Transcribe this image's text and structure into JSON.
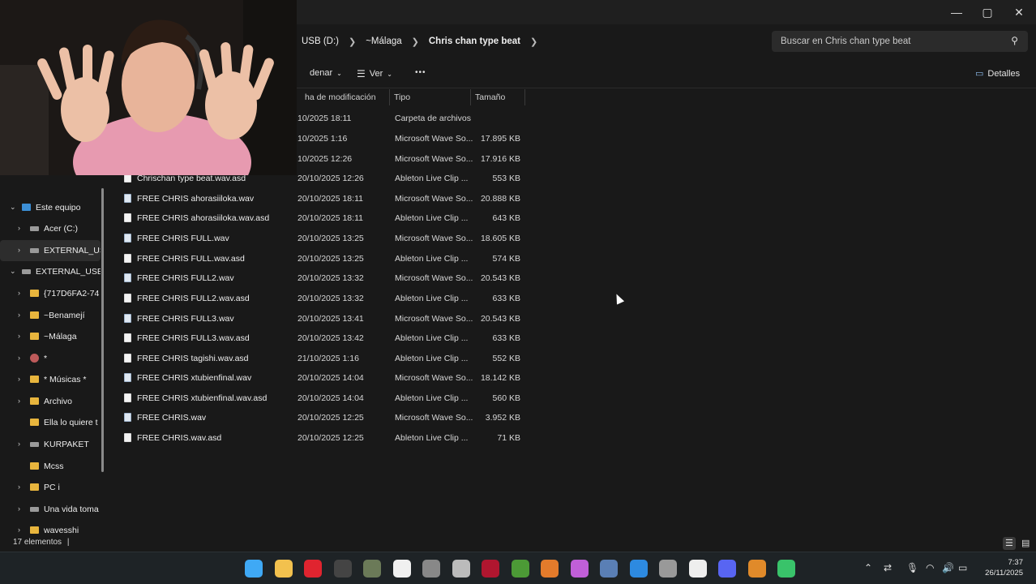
{
  "window": {
    "minimize": "—",
    "maximize": "▢",
    "close": "✕"
  },
  "address": {
    "crumbs": [
      "USB (D:)",
      "~Málaga",
      "Chris chan type beat"
    ],
    "search_placeholder": "Buscar en Chris chan type beat"
  },
  "toolbar": {
    "sort_label": "denar",
    "view_label": "Ver",
    "more_label": "•••",
    "details_label": "Detalles"
  },
  "columns": {
    "date": "ha de modificación",
    "type": "Tipo",
    "size": "Tamaño"
  },
  "files": [
    {
      "name": "",
      "date": "10/2025 18:11",
      "type": "Carpeta de archivos",
      "size": "",
      "kind": "folder"
    },
    {
      "name": "",
      "date": "10/2025 1:16",
      "type": "Microsoft Wave So...",
      "size": "17.895 KB",
      "kind": "wav"
    },
    {
      "name": "",
      "date": "10/2025 12:26",
      "type": "Microsoft Wave So...",
      "size": "17.916 KB",
      "kind": "wav"
    },
    {
      "name": "Chrischan type beat.wav.asd",
      "date": "20/10/2025 12:26",
      "type": "Ableton Live Clip ...",
      "size": "553 KB",
      "kind": "asd"
    },
    {
      "name": "FREE CHRIS ahorasiiloka.wav",
      "date": "20/10/2025 18:11",
      "type": "Microsoft Wave So...",
      "size": "20.888 KB",
      "kind": "wav"
    },
    {
      "name": "FREE CHRIS ahorasiiloka.wav.asd",
      "date": "20/10/2025 18:11",
      "type": "Ableton Live Clip ...",
      "size": "643 KB",
      "kind": "asd"
    },
    {
      "name": "FREE CHRIS FULL.wav",
      "date": "20/10/2025 13:25",
      "type": "Microsoft Wave So...",
      "size": "18.605 KB",
      "kind": "wav"
    },
    {
      "name": "FREE CHRIS FULL.wav.asd",
      "date": "20/10/2025 13:25",
      "type": "Ableton Live Clip ...",
      "size": "574 KB",
      "kind": "asd"
    },
    {
      "name": "FREE CHRIS FULL2.wav",
      "date": "20/10/2025 13:32",
      "type": "Microsoft Wave So...",
      "size": "20.543 KB",
      "kind": "wav"
    },
    {
      "name": "FREE CHRIS FULL2.wav.asd",
      "date": "20/10/2025 13:32",
      "type": "Ableton Live Clip ...",
      "size": "633 KB",
      "kind": "asd"
    },
    {
      "name": "FREE CHRIS FULL3.wav",
      "date": "20/10/2025 13:41",
      "type": "Microsoft Wave So...",
      "size": "20.543 KB",
      "kind": "wav"
    },
    {
      "name": "FREE CHRIS FULL3.wav.asd",
      "date": "20/10/2025 13:42",
      "type": "Ableton Live Clip ...",
      "size": "633 KB",
      "kind": "asd"
    },
    {
      "name": "FREE CHRIS tagishi.wav.asd",
      "date": "21/10/2025 1:16",
      "type": "Ableton Live Clip ...",
      "size": "552 KB",
      "kind": "asd"
    },
    {
      "name": "FREE CHRIS xtubienfinal.wav",
      "date": "20/10/2025 14:04",
      "type": "Microsoft Wave So...",
      "size": "18.142 KB",
      "kind": "wav"
    },
    {
      "name": "FREE CHRIS xtubienfinal.wav.asd",
      "date": "20/10/2025 14:04",
      "type": "Ableton Live Clip ...",
      "size": "560 KB",
      "kind": "asd"
    },
    {
      "name": "FREE CHRIS.wav",
      "date": "20/10/2025 12:25",
      "type": "Microsoft Wave So...",
      "size": "3.952 KB",
      "kind": "wav"
    },
    {
      "name": "FREE CHRIS.wav.asd",
      "date": "20/10/2025 12:25",
      "type": "Ableton Live Clip ...",
      "size": "71 KB",
      "kind": "asd"
    }
  ],
  "nav": [
    {
      "label": "Este equipo",
      "chev": "⌄",
      "icon": "pc",
      "indent": 0
    },
    {
      "label": "Acer (C:)",
      "chev": "›",
      "icon": "drive",
      "indent": 1
    },
    {
      "label": "EXTERNAL_USB",
      "chev": "›",
      "icon": "drive",
      "indent": 1,
      "selected": true
    },
    {
      "label": "EXTERNAL_USB",
      "chev": "⌄",
      "icon": "drive",
      "indent": 0
    },
    {
      "label": "{717D6FA2-74",
      "chev": "›",
      "icon": "folder",
      "indent": 1
    },
    {
      "label": "~Benamejí",
      "chev": "›",
      "icon": "folder",
      "indent": 1
    },
    {
      "label": "~Málaga",
      "chev": "›",
      "icon": "folder",
      "indent": 1
    },
    {
      "label": "*",
      "chev": "›",
      "icon": "other",
      "indent": 1
    },
    {
      "label": "* Músicas *",
      "chev": "›",
      "icon": "folder",
      "indent": 1
    },
    {
      "label": "Archivo",
      "chev": "›",
      "icon": "folder",
      "indent": 1
    },
    {
      "label": "Ella lo quiere t",
      "chev": "",
      "icon": "folder",
      "indent": 1
    },
    {
      "label": "KURPAKET",
      "chev": "›",
      "icon": "drive",
      "indent": 1
    },
    {
      "label": "Mcss",
      "chev": "",
      "icon": "folder",
      "indent": 1
    },
    {
      "label": "PC i",
      "chev": "›",
      "icon": "folder",
      "indent": 1
    },
    {
      "label": "Una vida toma",
      "chev": "›",
      "icon": "drive",
      "indent": 1
    },
    {
      "label": "wavesshi",
      "chev": "›",
      "icon": "folder",
      "indent": 1
    }
  ],
  "status": {
    "count": "17 elementos"
  },
  "taskbar": {
    "time": "7:37",
    "date": "26/11/2025",
    "icons": [
      {
        "name": "windows-start-icon",
        "color": "#3fa9f5"
      },
      {
        "name": "file-explorer-icon",
        "color": "#f2c14e"
      },
      {
        "name": "opera-icon",
        "color": "#e0242f"
      },
      {
        "name": "app-icon",
        "color": "#444"
      },
      {
        "name": "app-icon",
        "color": "#6b7a58"
      },
      {
        "name": "app-icon",
        "color": "#f0f0f0"
      },
      {
        "name": "app-icon",
        "color": "#888"
      },
      {
        "name": "app-icon",
        "color": "#bbb"
      },
      {
        "name": "app-icon",
        "color": "#b0162f"
      },
      {
        "name": "minecraft-icon",
        "color": "#4c9a36"
      },
      {
        "name": "settings-icon",
        "color": "#e37b2b"
      },
      {
        "name": "app-icon",
        "color": "#c05fd8"
      },
      {
        "name": "app-icon",
        "color": "#5a7fb5"
      },
      {
        "name": "app-icon",
        "color": "#2d8ae0"
      },
      {
        "name": "obs-icon",
        "color": "#999"
      },
      {
        "name": "capcut-icon",
        "color": "#eee"
      },
      {
        "name": "discord-icon",
        "color": "#5865f2"
      },
      {
        "name": "app-icon",
        "color": "#e08a2a"
      },
      {
        "name": "app-icon",
        "color": "#39c36a"
      }
    ]
  }
}
